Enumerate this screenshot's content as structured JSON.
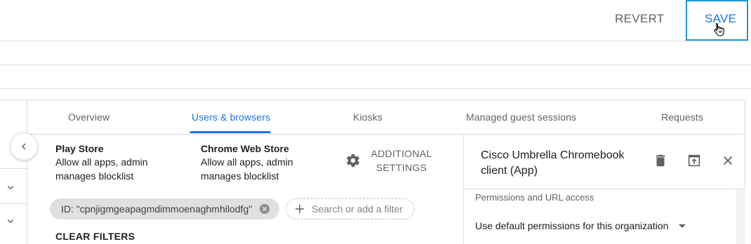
{
  "toolbar": {
    "revert_label": "REVERT",
    "save_label": "SAVE"
  },
  "tabs": [
    {
      "label": "Overview",
      "active": false
    },
    {
      "label": "Users & browsers",
      "active": true
    },
    {
      "label": "Kiosks",
      "active": false
    },
    {
      "label": "Managed guest sessions",
      "active": false
    },
    {
      "label": "Requests",
      "active": false
    }
  ],
  "stores": {
    "play_store": {
      "title": "Play Store",
      "description": "Allow all apps, admin manages blocklist"
    },
    "chrome_web_store": {
      "title": "Chrome Web Store",
      "description": "Allow all apps, admin manages blocklist"
    }
  },
  "additional_settings": {
    "line1": "ADDITIONAL",
    "line2": "SETTINGS",
    "icon": "gear-icon"
  },
  "filters": {
    "active_chip": "ID: \"cpnjigmgeapagmdimmoenaghmhilodfg\"",
    "search_placeholder": "Search or add a filter",
    "clear_label": "CLEAR FILTERS"
  },
  "detail_panel": {
    "app_title": "Cisco Umbrella Chromebook client (App)",
    "permissions_heading": "Permissions and URL access",
    "permissions_value": "Use default permissions for this organization",
    "icons": [
      "delete-icon",
      "open-in-new-icon",
      "close-icon"
    ]
  },
  "colors": {
    "accent": "#1a73e8",
    "focus_border": "#1a9bd7"
  }
}
